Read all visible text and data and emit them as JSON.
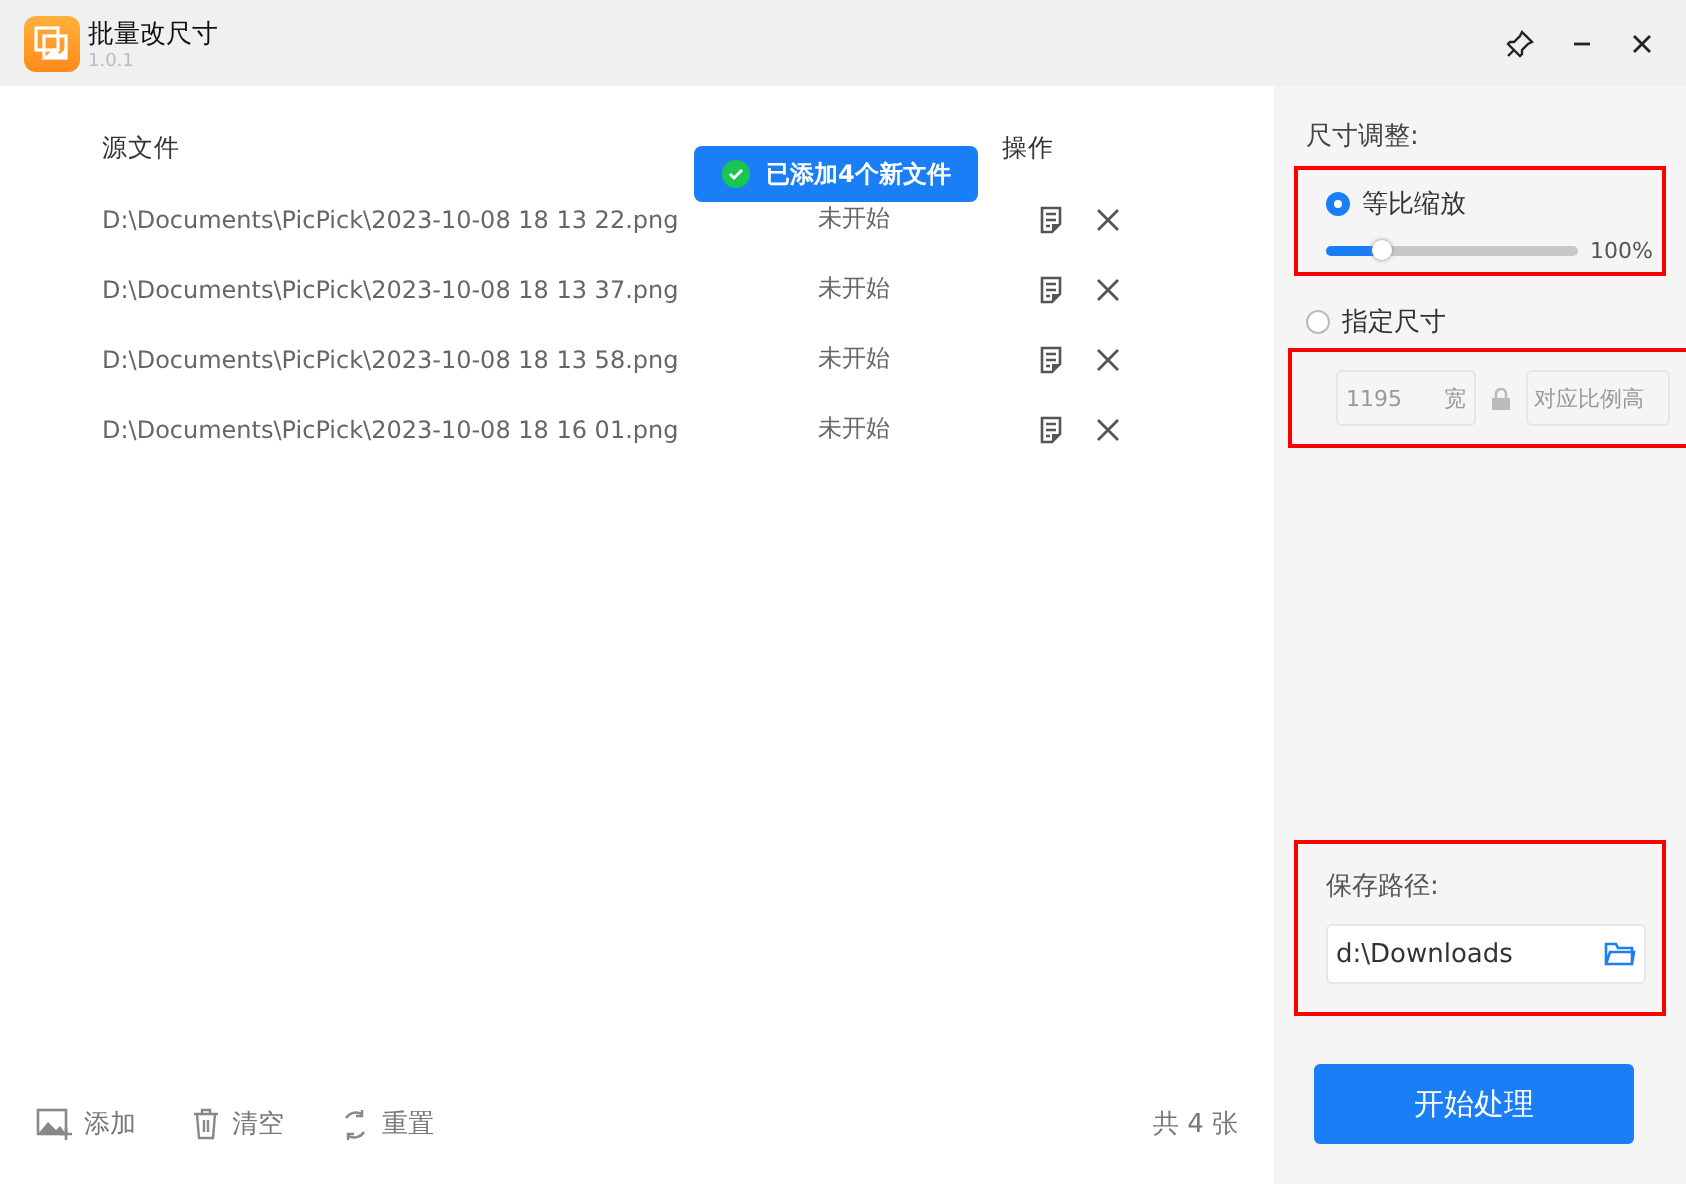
{
  "window": {
    "title": "批量改尺寸",
    "version": "1.0.1"
  },
  "table": {
    "columns": {
      "file": "源文件",
      "actions": "操作"
    },
    "rows": [
      {
        "file": "D:\\Documents\\PicPick\\2023-10-08 18 13 22.png",
        "status": "未开始"
      },
      {
        "file": "D:\\Documents\\PicPick\\2023-10-08 18 13 37.png",
        "status": "未开始"
      },
      {
        "file": "D:\\Documents\\PicPick\\2023-10-08 18 13 58.png",
        "status": "未开始"
      },
      {
        "file": "D:\\Documents\\PicPick\\2023-10-08 18 16 01.png",
        "status": "未开始"
      }
    ]
  },
  "toast": {
    "text": "已添加4个新文件"
  },
  "footer": {
    "buttons": [
      "添加",
      "清空",
      "重置"
    ],
    "count": "共 4 张"
  },
  "settings": {
    "title": "尺寸调整:",
    "modes": [
      {
        "label": "等比缩放",
        "selected": true
      },
      {
        "label": "指定尺寸",
        "selected": false
      }
    ],
    "scale": {
      "level": 0.22,
      "reading": "100%"
    },
    "width": {
      "value": "1195",
      "unit": "宽"
    },
    "height": {
      "placeholder": "对应比例高"
    },
    "save_label": "保存路径:",
    "save_path": "d:\\Downloads",
    "start": "开始处理"
  }
}
